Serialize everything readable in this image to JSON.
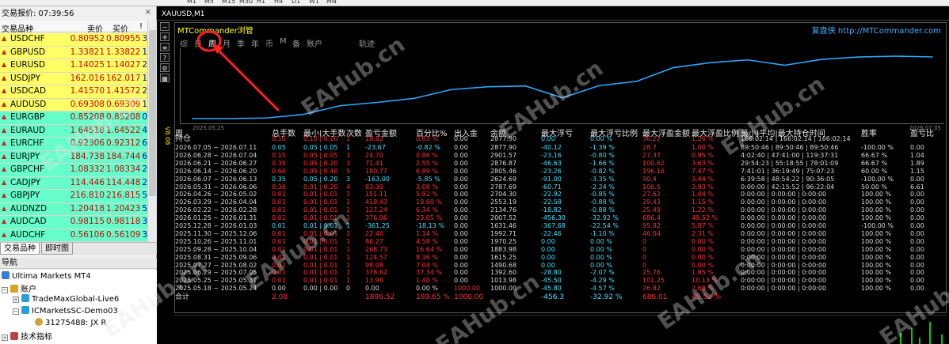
{
  "toolbar": {
    "timeframes": [
      "M1",
      "M5",
      "M15",
      "M30",
      "H1",
      "H4",
      "D1",
      "W1",
      "MN"
    ]
  },
  "market_watch": {
    "title": "交易报价: 07:39:56",
    "columns": {
      "symbol": "交易品种",
      "bid": "卖价",
      "ask": "买价",
      "spread": "!"
    },
    "rows": [
      {
        "symbol": "USDCHF",
        "bid": "0.80952",
        "ask": "0.80955",
        "spread": "3",
        "row_bg": "#ffff66",
        "dir": "up"
      },
      {
        "symbol": "GBPUSD",
        "bid": "1.33821",
        "ask": "1.33822",
        "spread": "1",
        "row_bg": "#ffff66",
        "dir": "up"
      },
      {
        "symbol": "EURUSD",
        "bid": "1.14025",
        "ask": "1.14027",
        "spread": "2",
        "row_bg": "#ffff66",
        "dir": "up"
      },
      {
        "symbol": "USDJPY",
        "bid": "162.016",
        "ask": "162.017",
        "spread": "1",
        "row_bg": "#ffff66",
        "dir": "up"
      },
      {
        "symbol": "USDCAD",
        "bid": "1.41570",
        "ask": "1.41572",
        "spread": "2",
        "row_bg": "#ffff66",
        "dir": "up"
      },
      {
        "symbol": "AUDUSD",
        "bid": "0.69308",
        "ask": "0.69309",
        "spread": "1",
        "row_bg": "#ffff66",
        "dir": "up"
      },
      {
        "symbol": "EURGBP",
        "bid": "0.85208",
        "ask": "0.85208",
        "spread": "0",
        "row_bg": "#66ffcc",
        "dir": "up"
      },
      {
        "symbol": "EURAUD",
        "bid": "1.64518",
        "ask": "1.64522",
        "spread": "4",
        "row_bg": "#66ffcc",
        "dir": "up"
      },
      {
        "symbol": "EURCHF",
        "bid": "0.92306",
        "ask": "0.92312",
        "spread": "6",
        "row_bg": "#66ffcc",
        "dir": "up"
      },
      {
        "symbol": "EURJPY",
        "bid": "184.738",
        "ask": "184.744",
        "spread": "6",
        "row_bg": "#66ffcc",
        "dir": "up"
      },
      {
        "symbol": "GBPCHF",
        "bid": "1.08332",
        "ask": "1.08334",
        "spread": "2",
        "row_bg": "#66ffcc",
        "dir": "up"
      },
      {
        "symbol": "CADJPY",
        "bid": "114.446",
        "ask": "114.448",
        "spread": "2",
        "row_bg": "#66ffcc",
        "dir": "up"
      },
      {
        "symbol": "GBPJPY",
        "bid": "216.810",
        "ask": "216.815",
        "spread": "5",
        "row_bg": "#66ffcc",
        "dir": "up"
      },
      {
        "symbol": "AUDNZD",
        "bid": "1.20418",
        "ask": "1.20423",
        "spread": "5",
        "row_bg": "#66ffcc",
        "dir": "up"
      },
      {
        "symbol": "AUDCAD",
        "bid": "0.98115",
        "ask": "0.98118",
        "spread": "3",
        "row_bg": "#66ffcc",
        "dir": "up"
      },
      {
        "symbol": "AUDCHF",
        "bid": "0.56106",
        "ask": "0.56109",
        "spread": "3",
        "row_bg": "#66ffcc",
        "dir": "up"
      }
    ],
    "tabs": [
      "交易品种",
      "即时图"
    ]
  },
  "navigator": {
    "title": "导航",
    "root": "Ultima Markets MT4",
    "accounts_label": "账户",
    "accounts": [
      "TradeMaxGlobal-Live6",
      "ICMarketsSC-Demo03"
    ],
    "sub_account": "31275488: JX R",
    "indicators_label": "技术指标"
  },
  "chart": {
    "window_title": "XAUUSD,M1",
    "vertical_label": "V8.08",
    "tool_icons": [
      "minus-icon",
      "crosshair-icon",
      "list-icon",
      "help-icon",
      "settings-icon",
      "tile-icon"
    ],
    "panel_title": "MTCommander浏管",
    "brand": "复盘侠 http://MTCommander.com",
    "menu": [
      {
        "label": "综",
        "active": false
      },
      {
        "label": "日",
        "active": false
      },
      {
        "label": "周",
        "active": true
      },
      {
        "label": "月",
        "active": false
      },
      {
        "label": "季",
        "active": false
      },
      {
        "label": "年",
        "active": false
      },
      {
        "label": "币",
        "active": false
      },
      {
        "label": "M",
        "active": false
      },
      {
        "label": "备",
        "active": false
      },
      {
        "label": "账户",
        "active": false
      },
      {
        "label": "轨迹",
        "active": false
      }
    ],
    "graph_start_date": "2025.05.25",
    "graph_end_date": "2026.07.05",
    "equity_curve": [
      1000,
      1000,
      1013.98,
      1124.9,
      1392.6,
      1490.68,
      1615.25,
      1883.98,
      1970.25,
      1992.71,
      1631.46,
      2007.52,
      2134.76,
      2553.19,
      2704.3,
      2787.69,
      2624.69,
      2805.46,
      2876.87,
      2901.57,
      2877.9
    ],
    "table": {
      "headers": {
        "week": "周",
        "holdings": "持仓",
        "lots": "总手数",
        "minmax": "最小|大手数",
        "count": "次数",
        "pnl": "盈亏金额",
        "pct": "百分比%",
        "inout": "出入金",
        "balance": "余额",
        "maxdd": "最大浮亏",
        "maxddpct": "最大浮亏比例",
        "maxfp": "最大浮盈金额",
        "maxfppct": "最大浮盈比例",
        "hold": "最小|平均|最大持仓时间",
        "win": "胜率",
        "pf": "盈亏比"
      },
      "holding_row": {
        "lots": "0.10",
        "minmax": "0.10 | 0.10",
        "count": "1",
        "pnl": "18.62",
        "pct": "0.65 %",
        "inout": "0.00",
        "balance": "2877.90",
        "maxdd": "0.00",
        "maxddpct": "0.00 %",
        "maxfp": "36.22",
        "maxfppct": "1.26 %",
        "hold": "166:02:14 | 166:02:14 | 166:02:14",
        "win": "",
        "pf": ""
      },
      "rows": [
        {
          "week": "2026.07.05 ~ 2026.07.11",
          "lots": "0.05",
          "minmax": "0.05 | 0.05",
          "count": "1",
          "pnl": "-23.67",
          "pct": "-0.82 %",
          "inout": "0.00",
          "balance": "2877.90",
          "maxdd": "-40.12",
          "maxddpct": "-1.39 %",
          "maxfp": "28.7",
          "maxfppct": "1.00 %",
          "hold": "89:50:46 | 89:50:46 | 89:50:46",
          "win": "-100.00 %",
          "pf": "0.00",
          "pos": false
        },
        {
          "week": "2026.06.28 ~ 2026.07.04",
          "lots": "0.15",
          "minmax": "0.05 | 0.05",
          "count": "3",
          "pnl": "24.70",
          "pct": "0.86 %",
          "inout": "0.00",
          "balance": "2901.57",
          "maxdd": "-23.16",
          "maxddpct": "-0.80 %",
          "maxfp": "27.37",
          "maxfppct": "0.95 %",
          "hold": "4:02:40 | 47:41:00 | 119:37:31",
          "win": "66.67 %",
          "pf": "1.04",
          "pos": true
        },
        {
          "week": "2026.06.21 ~ 2026.06.27",
          "lots": "0.35",
          "minmax": "0.05 | 0.20",
          "count": "3",
          "pnl": "71.41",
          "pct": "2.55 %",
          "inout": "0.00",
          "balance": "2876.87",
          "maxdd": "-46.63",
          "maxddpct": "-1.66 %",
          "maxfp": "100.62",
          "maxfppct": "3.63 %",
          "hold": "29:54:23 | 55:18:55 | 78:01:09",
          "win": "66.67 %",
          "pf": "1.89",
          "pos": true
        },
        {
          "week": "2026.06.14 ~ 2026.06.20",
          "lots": "0.60",
          "minmax": "0.05 | 0.40",
          "count": "5",
          "pnl": "180.77",
          "pct": "6.89 %",
          "inout": "0.00",
          "balance": "2805.46",
          "maxdd": "-23.26",
          "maxddpct": "-0.82 %",
          "maxfp": "196.16",
          "maxfppct": "7.47 %",
          "hold": "7:41:01 | 36:19:49 | 75:07:23",
          "win": "60.00 %",
          "pf": "1.15",
          "pos": true
        },
        {
          "week": "2026.06.07 ~ 2026.06.13",
          "lots": "0.35",
          "minmax": "0.05 | 0.20",
          "count": "3",
          "pnl": "-163.00",
          "pct": "-5.85 %",
          "inout": "0.00",
          "balance": "2624.69",
          "maxdd": "-91.00",
          "maxddpct": "-3.35 %",
          "maxfp": "90.4",
          "maxfppct": "3.44 %",
          "hold": "6:39:58 | 48:54:22 | 90:36:05",
          "win": "-100.00 %",
          "pf": "0.00",
          "pos": false
        },
        {
          "week": "2026.05.31 ~ 2026.06.06",
          "lots": "0.36",
          "minmax": "0.01 | 0.20",
          "count": "4",
          "pnl": "83.39",
          "pct": "3.08 %",
          "inout": "0.00",
          "balance": "2787.69",
          "maxdd": "-60.71",
          "maxddpct": "-2.24 %",
          "maxfp": "106.5",
          "maxfppct": "3.93 %",
          "hold": "0:00:00 | 42:15:52 | 96:22:04",
          "win": "50.00 %",
          "pf": "6.61",
          "pos": true
        },
        {
          "week": "2026.04.26 ~ 2026.05.02",
          "lots": "0.01",
          "minmax": "0.01 | 0.01",
          "count": "1",
          "pnl": "151.11",
          "pct": "5.92 %",
          "inout": "0.00",
          "balance": "2704.30",
          "maxdd": "-22.92",
          "maxddpct": "-0.85 %",
          "maxfp": "27.62",
          "maxfppct": "1.04 %",
          "hold": "0:00:00 | 0:00:00 | 0:00:00",
          "win": "100.00 %",
          "pf": "0.00",
          "pos": true
        },
        {
          "week": "2026.03.29 ~ 2026.04.04",
          "lots": "0.01",
          "minmax": "0.01 | 0.01",
          "count": "1",
          "pnl": "418.43",
          "pct": "19.60 %",
          "inout": "0.00",
          "balance": "2553.19",
          "maxdd": "-22.58",
          "maxddpct": "-0.88 %",
          "maxfp": "29.43",
          "maxfppct": "1.15 %",
          "hold": "0:00:00 | 0:00:00 | 0:00:00",
          "win": "100.00 %",
          "pf": "0.00",
          "pos": true
        },
        {
          "week": "2026.02.22 ~ 2026.02.28",
          "lots": "0.01",
          "minmax": "0.01 | 0.01",
          "count": "1",
          "pnl": "127.24",
          "pct": "6.34 %",
          "inout": "0.00",
          "balance": "2134.76",
          "maxdd": "-18.82",
          "maxddpct": "-0.88 %",
          "maxfp": "25.49",
          "maxfppct": "1.22 %",
          "hold": "0:00:00 | 0:00:00 | 0:00:00",
          "win": "100.00 %",
          "pf": "0.00",
          "pos": true
        },
        {
          "week": "2026.01.25 ~ 2026.01.31",
          "lots": "0.01",
          "minmax": "0.01 | 0.01",
          "count": "1",
          "pnl": "376.06",
          "pct": "23.05 %",
          "inout": "0.00",
          "balance": "2007.52",
          "maxdd": "-456.30",
          "maxddpct": "-32.92 %",
          "maxfp": "686.4",
          "maxfppct": "49.52 %",
          "hold": "0:00:00 | 0:00:00 | 0:00:00",
          "win": "100.00 %",
          "pf": "0.00",
          "pos": true
        },
        {
          "week": "2025.12.28 ~ 2026.01.03",
          "lots": "0.01",
          "minmax": "0.01 | 0.01",
          "count": "1",
          "pnl": "-361.25",
          "pct": "-18.13 %",
          "inout": "0.00",
          "balance": "1631.46",
          "maxdd": "-367.68",
          "maxddpct": "-22.54 %",
          "maxfp": "95.82",
          "maxfppct": "5.87 %",
          "hold": "0:00:00 | 0:00:00 | 0:00:00",
          "win": "-100.00 %",
          "pf": "0.00",
          "pos": false
        },
        {
          "week": "2025.11.30 ~ 2025.12.06",
          "lots": "0.01",
          "minmax": "0.01 | 0.01",
          "count": "1",
          "pnl": "22.46",
          "pct": "1.14 %",
          "inout": "0.00",
          "balance": "1992.71",
          "maxdd": "-22.46",
          "maxddpct": "-1.10 %",
          "maxfp": "46.04",
          "maxfppct": "2.31 %",
          "hold": "0:00:00 | 0:00:00 | 0:00:00",
          "win": "100.00 %",
          "pf": "0.00",
          "pos": true
        },
        {
          "week": "2025.10.26 ~ 2025.11.01",
          "lots": "0.01",
          "minmax": "0.01 | 0.01",
          "count": "1",
          "pnl": "86.27",
          "pct": "4.58 %",
          "inout": "0.00",
          "balance": "1970.25",
          "maxdd": "0.00",
          "maxddpct": "0.00 %",
          "maxfp": "0",
          "maxfppct": "0.00 %",
          "hold": "0:00:00 | 0:00:00 | 0:00:00",
          "win": "100.00 %",
          "pf": "0.00",
          "pos": true
        },
        {
          "week": "2025.09.28 ~ 2025.10.04",
          "lots": "0.01",
          "minmax": "0.01 | 0.01",
          "count": "1",
          "pnl": "268.73",
          "pct": "16.64 %",
          "inout": "0.00",
          "balance": "1883.98",
          "maxdd": "0.00",
          "maxddpct": "0.00 %",
          "maxfp": "0",
          "maxfppct": "0.00 %",
          "hold": "0:00:00 | 0:00:00 | 0:00:00",
          "win": "100.00 %",
          "pf": "0.00",
          "pos": true
        },
        {
          "week": "2025.08.31 ~ 2025.09.06",
          "lots": "0.01",
          "minmax": "0.01 | 0.01",
          "count": "1",
          "pnl": "124.57",
          "pct": "8.36 %",
          "inout": "0.00",
          "balance": "1615.25",
          "maxdd": "0.00",
          "maxddpct": "0.00 %",
          "maxfp": "0",
          "maxfppct": "0.00 %",
          "hold": "0:00:00 | 0:00:00 | 0:00:00",
          "win": "100.00 %",
          "pf": "0.00",
          "pos": true
        },
        {
          "week": "2025.07.27 ~ 2025.08.02",
          "lots": "0.01",
          "minmax": "0.01 | 0.01",
          "count": "1",
          "pnl": "98.08",
          "pct": "7.04 %",
          "inout": "0.00",
          "balance": "1490.68",
          "maxdd": "0.00",
          "maxddpct": "0.00 %",
          "maxfp": "0",
          "maxfppct": "0.00 %",
          "hold": "0:00:00 | 0:00:00 | 0:00:00",
          "win": "100.00 %",
          "pf": "0.00",
          "pos": true
        },
        {
          "week": "2025.06.29 ~ 2025.07.05",
          "lots": "0.01",
          "minmax": "0.01 | 0.01",
          "count": "1",
          "pnl": "378.62",
          "pct": "37.34 %",
          "inout": "0.00",
          "balance": "1392.60",
          "maxdd": "-28.80",
          "maxddpct": "-2.07 %",
          "maxfp": "25.76",
          "maxfppct": "1.85 %",
          "hold": "0:00:00 | 0:00:00 | 0:00:00",
          "win": "100.00 %",
          "pf": "0.00",
          "pos": true
        },
        {
          "week": "2025.05.25 ~ 2025.05.31",
          "lots": "0.01",
          "minmax": "0.01 | 0.01",
          "count": "1",
          "pnl": "13.98",
          "pct": "1.40 %",
          "inout": "0.00",
          "balance": "1013.98",
          "maxdd": "-45.50",
          "maxddpct": "-4.29 %",
          "maxfp": "101.25",
          "maxfppct": "10.13 %",
          "hold": "0:00:00 | 0:00:00 | 0:00:00",
          "win": "100.00 %",
          "pf": "0.00",
          "pos": true
        },
        {
          "week": "2025.05.18 ~ 2025.05.24",
          "lots": "0.00",
          "minmax": "0.00 | 0.00",
          "count": "0",
          "pnl": "0.00",
          "pct": "0.00 %",
          "inout": "1000.00",
          "balance": "1000.00",
          "maxdd": "-45.80",
          "maxddpct": "-4.57 %",
          "maxfp": "26.82",
          "maxfppct": "2.68 %",
          "hold": "0:00:00 | 0:00:00 | 0:00:00",
          "win": "100.00 %",
          "pf": "0.00",
          "pos": null
        }
      ],
      "footer": {
        "label": "合计",
        "lots": "2.08",
        "pnl": "1896.52",
        "pct": "189.65 %",
        "inout": "1000.00",
        "maxdd": "-456.3",
        "maxddpct": "-32.92 %",
        "maxfp": "686.01",
        "maxfppct": "49.52 %"
      }
    }
  },
  "watermark": "EAHub.cn",
  "colors": {
    "cyan": "#3fe0ff",
    "red": "#ff3030",
    "yellow": "#ffff00",
    "curve": "#29a8ff",
    "annotation": "#ff2020"
  }
}
